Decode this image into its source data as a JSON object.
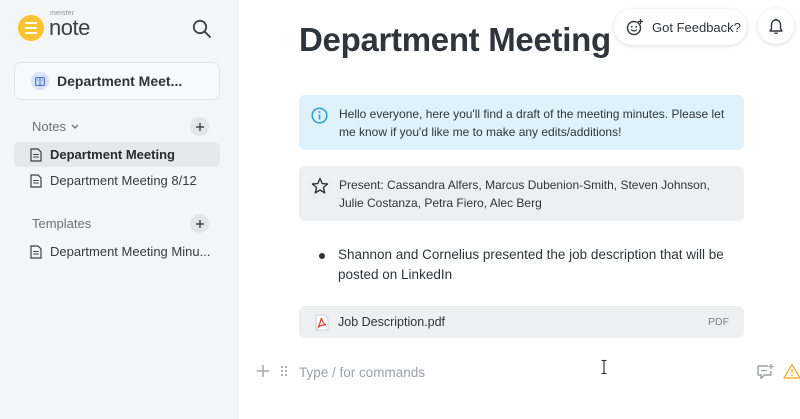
{
  "brand": {
    "small": "meister",
    "name": "note"
  },
  "sidebar": {
    "project_title": "Department Meet...",
    "notes_label": "Notes",
    "notes": [
      {
        "label": "Department Meeting",
        "active": true
      },
      {
        "label": "Department Meeting 8/12",
        "active": false
      }
    ],
    "templates_label": "Templates",
    "templates": [
      {
        "label": "Department Meeting Minu..."
      }
    ]
  },
  "header": {
    "feedback_label": "Got Feedback?"
  },
  "page": {
    "title": "Department Meeting",
    "info_callout": "Hello everyone, here you'll find a draft of the meeting minutes. Please let me know if you'd like me to make any edits/additions!",
    "present_callout": "Present: Cassandra Alfers, Marcus Dubenion-Smith, Steven Johnson, Julie Costanza, Petra Fiero, Alec Berg",
    "bullet": "Shannon and Cornelius presented the job description that will be posted on LinkedIn",
    "attachment": {
      "name": "Job Description.pdf",
      "type": "PDF"
    },
    "command_placeholder": "Type / for commands"
  },
  "colors": {
    "accent_yellow": "#f6c531",
    "info_bg": "#dff1fb",
    "info_icon": "#2a9fd8",
    "pdf_red": "#d9453b"
  },
  "icons": [
    "search-icon",
    "notebook-icon",
    "chevron-down-icon",
    "plus-icon",
    "document-icon",
    "feedback-emoji-icon",
    "bell-icon",
    "info-icon",
    "star-icon",
    "pdf-icon",
    "drag-handle-icon",
    "comment-add-icon",
    "warning-icon",
    "text-cursor-icon"
  ]
}
